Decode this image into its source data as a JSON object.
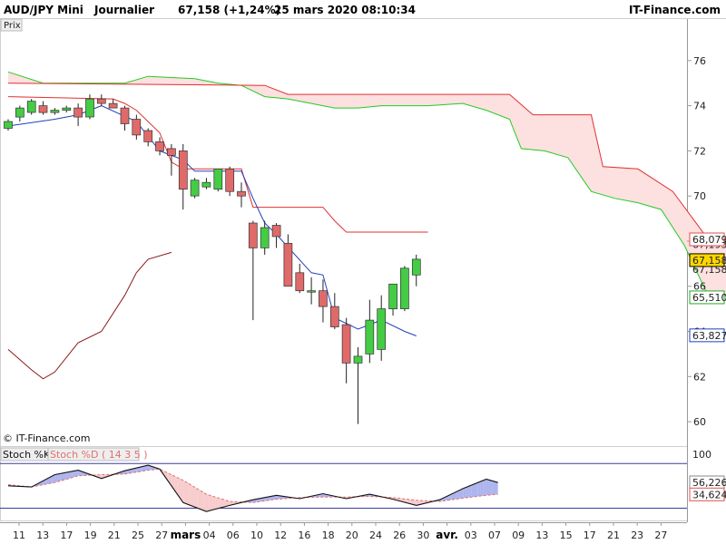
{
  "header": {
    "symbol": "AUD/JPY Mini",
    "period": "Journalier",
    "last": "67,158 (+1,24%)",
    "datetime": "25 mars 2020 08:10:34",
    "brand": "IT-Finance.com"
  },
  "price_panel": {
    "tab_label": "Prix",
    "watermark": "© IT-Finance.com",
    "y_ticks": [
      "76",
      "74",
      "72",
      "70",
      "68",
      "66",
      "64",
      "62",
      "60"
    ],
    "badges": [
      {
        "text": "68,079",
        "value": 68.079,
        "color": "#e05050",
        "fill": "#ffffff"
      },
      {
        "text": "67,158",
        "value": 67.158,
        "color": "#000000",
        "fill": "#ffd700"
      },
      {
        "text": "65,510",
        "value": 65.51,
        "color": "#22aa22",
        "fill": "#ffffff"
      },
      {
        "text": "63,827",
        "value": 63.827,
        "color": "#2040c0",
        "fill": "#ffffff"
      }
    ],
    "partial_badges": [
      "67,193",
      "67,158"
    ]
  },
  "stoch_panel": {
    "label_k": "Stoch %K",
    "label_d": "Stoch %D ( 14 3 5 )",
    "y_ticks": [
      "100"
    ],
    "badges": [
      {
        "text": "56,226",
        "value": 56.226,
        "color": "#000000"
      },
      {
        "text": "34,624",
        "value": 34.624,
        "color": "#e05050"
      }
    ]
  },
  "x_axis": {
    "labels": [
      "11",
      "13",
      "17",
      "19",
      "21",
      "25",
      "27",
      "mars",
      "04",
      "06",
      "10",
      "12",
      "16",
      "18",
      "20",
      "24",
      "26",
      "30",
      "avr.",
      "03",
      "07",
      "09",
      "13",
      "15",
      "17",
      "21",
      "23",
      "27"
    ],
    "major": [
      "mars",
      "avr."
    ]
  },
  "colors": {
    "up_candle": "#44cc44",
    "down_candle": "#e06a6a",
    "kijun": "#e03030",
    "tenkan": "#2040c0",
    "senkou_a": "#22cc22",
    "senkou_b": "#e03030",
    "cloud_fill": "#fde0e0",
    "chikou": "#8b1a1a",
    "stoch_k": "#111111",
    "stoch_d": "#e07070"
  },
  "chart_data": [
    {
      "type": "candlestick",
      "title": "AUD/JPY Mini",
      "ylim": [
        59,
        77.8
      ],
      "candles": [
        {
          "o": 73.0,
          "h": 73.4,
          "l": 72.9,
          "c": 73.3
        },
        {
          "o": 73.5,
          "h": 74.0,
          "l": 73.3,
          "c": 73.9
        },
        {
          "o": 73.7,
          "h": 74.3,
          "l": 73.6,
          "c": 74.2
        },
        {
          "o": 74.0,
          "h": 74.2,
          "l": 73.6,
          "c": 73.7
        },
        {
          "o": 73.7,
          "h": 73.9,
          "l": 73.6,
          "c": 73.8
        },
        {
          "o": 73.8,
          "h": 74.0,
          "l": 73.7,
          "c": 73.9
        },
        {
          "o": 73.9,
          "h": 74.1,
          "l": 73.1,
          "c": 73.5
        },
        {
          "o": 73.5,
          "h": 74.5,
          "l": 73.4,
          "c": 74.3
        },
        {
          "o": 74.3,
          "h": 74.5,
          "l": 74.0,
          "c": 74.1
        },
        {
          "o": 74.1,
          "h": 74.3,
          "l": 73.9,
          "c": 73.9
        },
        {
          "o": 73.9,
          "h": 74.0,
          "l": 72.9,
          "c": 73.2
        },
        {
          "o": 73.4,
          "h": 73.6,
          "l": 72.5,
          "c": 72.7
        },
        {
          "o": 72.9,
          "h": 73.0,
          "l": 72.2,
          "c": 72.4
        },
        {
          "o": 72.4,
          "h": 72.6,
          "l": 71.8,
          "c": 72.0
        },
        {
          "o": 72.1,
          "h": 72.3,
          "l": 70.9,
          "c": 71.8
        },
        {
          "o": 72.0,
          "h": 72.3,
          "l": 69.4,
          "c": 70.3
        },
        {
          "o": 70.0,
          "h": 70.8,
          "l": 69.9,
          "c": 70.7
        },
        {
          "o": 70.4,
          "h": 70.8,
          "l": 70.3,
          "c": 70.6
        },
        {
          "o": 70.3,
          "h": 71.2,
          "l": 70.2,
          "c": 71.2
        },
        {
          "o": 71.2,
          "h": 71.3,
          "l": 70.0,
          "c": 70.2
        },
        {
          "o": 70.2,
          "h": 70.6,
          "l": 69.5,
          "c": 70.0
        },
        {
          "o": 68.8,
          "h": 68.9,
          "l": 64.5,
          "c": 67.7
        },
        {
          "o": 67.7,
          "h": 68.9,
          "l": 67.4,
          "c": 68.6
        },
        {
          "o": 68.7,
          "h": 68.8,
          "l": 67.7,
          "c": 68.2
        },
        {
          "o": 67.9,
          "h": 68.3,
          "l": 66.0,
          "c": 66.0
        },
        {
          "o": 66.6,
          "h": 67.0,
          "l": 65.7,
          "c": 65.8
        },
        {
          "o": 65.8,
          "h": 66.4,
          "l": 65.2,
          "c": 65.8
        },
        {
          "o": 65.8,
          "h": 66.3,
          "l": 64.4,
          "c": 65.1
        },
        {
          "o": 65.1,
          "h": 65.7,
          "l": 64.1,
          "c": 64.2
        },
        {
          "o": 64.3,
          "h": 64.6,
          "l": 61.7,
          "c": 62.6
        },
        {
          "o": 62.6,
          "h": 63.3,
          "l": 59.9,
          "c": 62.9
        },
        {
          "o": 63.0,
          "h": 65.4,
          "l": 62.6,
          "c": 64.5
        },
        {
          "o": 63.2,
          "h": 65.6,
          "l": 62.7,
          "c": 65.0
        },
        {
          "o": 65.0,
          "h": 65.5,
          "l": 64.7,
          "c": 66.1
        },
        {
          "o": 65.0,
          "h": 66.9,
          "l": 64.9,
          "c": 66.8
        },
        {
          "o": 66.5,
          "h": 67.4,
          "l": 66.0,
          "c": 67.2
        }
      ],
      "tenkan": [
        [
          0,
          73.1
        ],
        [
          4,
          73.4
        ],
        [
          6,
          73.6
        ],
        [
          8,
          74.0
        ],
        [
          11,
          73.3
        ],
        [
          13,
          72.0
        ],
        [
          15,
          71.6
        ],
        [
          16,
          71.1
        ],
        [
          20,
          71.1
        ],
        [
          21,
          69.9
        ],
        [
          22,
          68.8
        ],
        [
          23,
          68.3
        ],
        [
          26,
          66.6
        ],
        [
          27,
          66.5
        ],
        [
          28,
          64.6
        ],
        [
          30,
          64.1
        ],
        [
          32,
          64.5
        ],
        [
          34,
          64.0
        ],
        [
          35,
          63.8
        ]
      ],
      "kijun": [
        [
          0,
          74.4
        ],
        [
          9,
          74.3
        ],
        [
          10,
          74.1
        ],
        [
          11,
          73.8
        ],
        [
          13,
          72.8
        ],
        [
          14,
          71.5
        ],
        [
          15,
          71.2
        ],
        [
          20,
          71.2
        ],
        [
          21,
          69.5
        ],
        [
          27,
          69.5
        ],
        [
          28,
          68.9
        ],
        [
          29,
          68.4
        ],
        [
          36,
          68.4
        ]
      ],
      "senkou_a": [
        [
          0,
          75.5
        ],
        [
          3,
          75.0
        ],
        [
          10,
          75.0
        ],
        [
          12,
          75.3
        ],
        [
          16,
          75.2
        ],
        [
          18,
          75.0
        ],
        [
          20,
          74.9
        ],
        [
          22,
          74.4
        ],
        [
          24,
          74.3
        ],
        [
          28,
          73.9
        ],
        [
          30,
          73.9
        ],
        [
          32,
          74.0
        ],
        [
          36,
          74.0
        ],
        [
          39,
          74.1
        ],
        [
          41,
          73.8
        ],
        [
          43,
          73.4
        ],
        [
          44,
          72.1
        ],
        [
          46,
          72.0
        ],
        [
          48,
          71.7
        ],
        [
          50,
          70.2
        ],
        [
          52,
          69.9
        ],
        [
          54,
          69.7
        ],
        [
          56,
          69.4
        ],
        [
          58,
          67.8
        ],
        [
          60,
          65.6
        ],
        [
          62,
          65.6
        ]
      ],
      "senkou_b": [
        [
          0,
          75.0
        ],
        [
          22,
          74.9
        ],
        [
          24,
          74.5
        ],
        [
          43,
          74.5
        ],
        [
          45,
          73.6
        ],
        [
          50,
          73.6
        ],
        [
          51,
          71.3
        ],
        [
          54,
          71.2
        ],
        [
          57,
          70.2
        ],
        [
          60,
          68.1
        ],
        [
          62,
          68.1
        ]
      ],
      "chikou": [
        [
          0,
          63.2
        ],
        [
          2,
          62.3
        ],
        [
          3,
          61.9
        ],
        [
          4,
          62.2
        ],
        [
          6,
          63.5
        ],
        [
          8,
          64.0
        ],
        [
          10,
          65.6
        ],
        [
          11,
          66.6
        ],
        [
          12,
          67.2
        ],
        [
          14,
          67.5
        ]
      ]
    },
    {
      "type": "line",
      "title": "Stoch %K / Stoch %D ( 14 3 5 )",
      "ylim": [
        -12,
        118
      ],
      "ref_lines": [
        90,
        10
      ],
      "series": [
        {
          "name": "Stoch %K",
          "points": [
            [
              0,
              50
            ],
            [
              2,
              48
            ],
            [
              4,
              70
            ],
            [
              6,
              78
            ],
            [
              8,
              63
            ],
            [
              10,
              77
            ],
            [
              12,
              87
            ],
            [
              13,
              80
            ],
            [
              15,
              20
            ],
            [
              17,
              4
            ],
            [
              19,
              15
            ],
            [
              21,
              25
            ],
            [
              23,
              33
            ],
            [
              25,
              27
            ],
            [
              27,
              36
            ],
            [
              29,
              27
            ],
            [
              31,
              35
            ],
            [
              33,
              26
            ],
            [
              35,
              15
            ],
            [
              37,
              25
            ],
            [
              39,
              45
            ],
            [
              41,
              62
            ],
            [
              42,
              56
            ]
          ]
        },
        {
          "name": "Stoch %D ( 14 3 5 )",
          "points": [
            [
              0,
              52
            ],
            [
              2,
              48
            ],
            [
              4,
              56
            ],
            [
              6,
              68
            ],
            [
              8,
              70
            ],
            [
              10,
              71
            ],
            [
              12,
              78
            ],
            [
              13,
              80
            ],
            [
              15,
              60
            ],
            [
              17,
              35
            ],
            [
              19,
              22
            ],
            [
              21,
              20
            ],
            [
              23,
              26
            ],
            [
              25,
              29
            ],
            [
              27,
              30
            ],
            [
              29,
              30
            ],
            [
              31,
              31
            ],
            [
              33,
              29
            ],
            [
              35,
              24
            ],
            [
              37,
              22
            ],
            [
              39,
              28
            ],
            [
              41,
              33
            ],
            [
              42,
              35
            ]
          ]
        }
      ]
    }
  ]
}
